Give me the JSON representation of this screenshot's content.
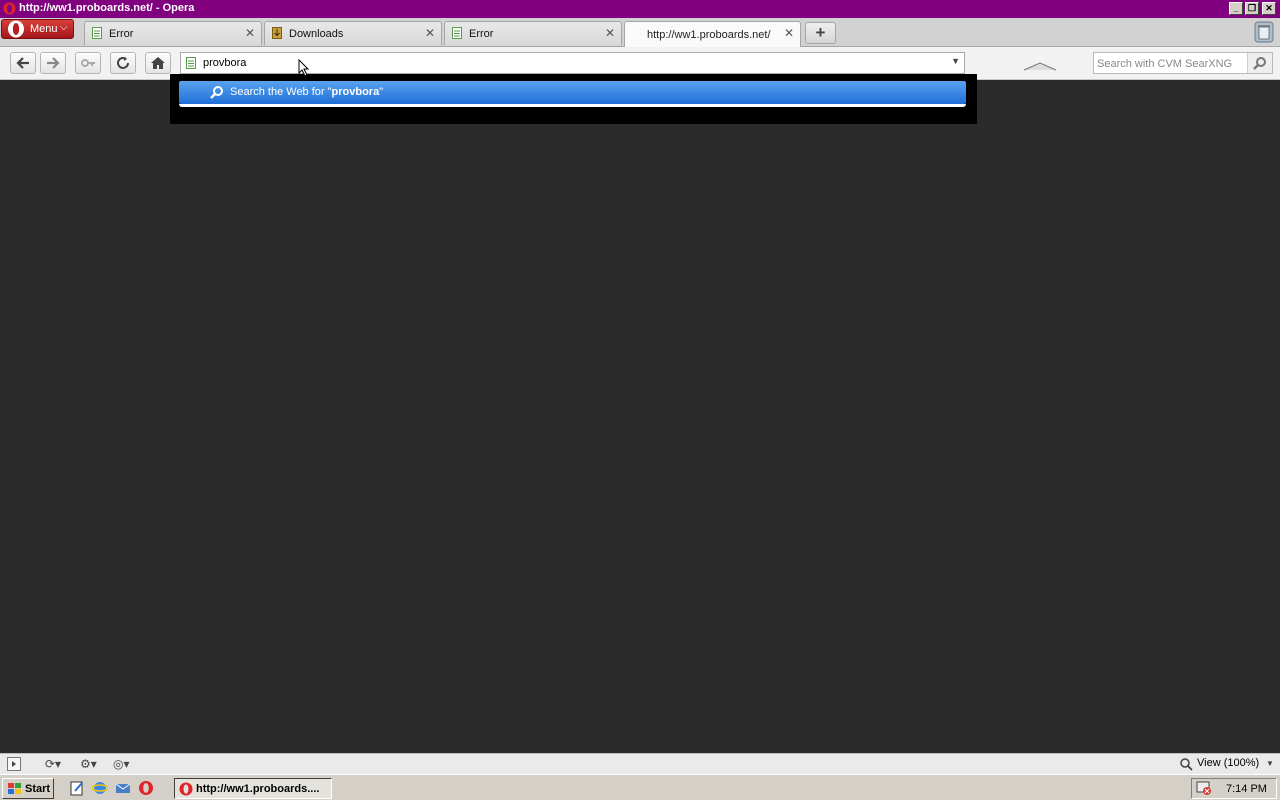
{
  "window": {
    "title": "http://ww1.proboards.net/ - Opera"
  },
  "menu": {
    "label": "Menu"
  },
  "tabs": [
    {
      "label": "Error",
      "icon": "page-icon"
    },
    {
      "label": "Downloads",
      "icon": "downloads-icon"
    },
    {
      "label": "Error",
      "icon": "page-icon"
    },
    {
      "label": "http://ww1.proboards.net/",
      "icon": "none",
      "active": true
    }
  ],
  "address_bar": {
    "value": "provbora"
  },
  "search_box": {
    "placeholder": "Search with CVM SearXNG"
  },
  "suggestion": {
    "prefix": "Search the Web for \"",
    "query": "provbora",
    "suffix": "\""
  },
  "status_bar": {
    "zoom": "View (100%)"
  },
  "taskbar": {
    "start_label": "Start",
    "task_item": "http://ww1.proboards....",
    "clock": "7:14 PM"
  },
  "colors": {
    "title_bar": "#800080",
    "page_background": "#2b2b2b",
    "suggestion_highlight": "#1f6fd8",
    "menu_button": "#c0282a"
  }
}
